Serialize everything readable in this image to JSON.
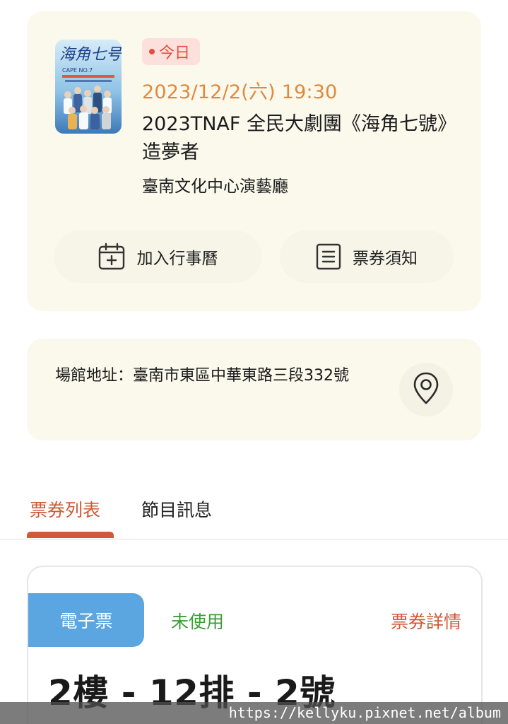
{
  "event": {
    "badge": "今日",
    "datetime": "2023/12/2(六) 19:30",
    "title": "2023TNAF 全民大劇團《海角七號》造夢者",
    "venue": "臺南文化中心演藝廳",
    "poster": {
      "title_text": "海角七号",
      "subtitle_text": "CAPE NO.7"
    }
  },
  "actions": {
    "add_calendar": "加入行事曆",
    "ticket_notice": "票券須知"
  },
  "address": {
    "text": "場館地址：臺南市東區中華東路三段332號"
  },
  "tabs": [
    {
      "label": "票券列表",
      "active": true
    },
    {
      "label": "節目訊息",
      "active": false
    }
  ],
  "ticket": {
    "type": "電子票",
    "status": "未使用",
    "detail_link": "票券詳情",
    "seat": "2樓 - 12排 - 2號"
  },
  "watermark": "https://kellyku.pixnet.net/album",
  "colors": {
    "card_bg": "#fbf8ec",
    "accent_orange": "#e0893c",
    "accent_red": "#cf5a37",
    "badge_red": "#e0503f",
    "eticket_blue": "#5ba6e1",
    "status_green": "#3f9b3c"
  },
  "icons": {
    "calendar": "calendar-plus-icon",
    "notice": "document-list-icon",
    "map": "map-pin-icon"
  }
}
